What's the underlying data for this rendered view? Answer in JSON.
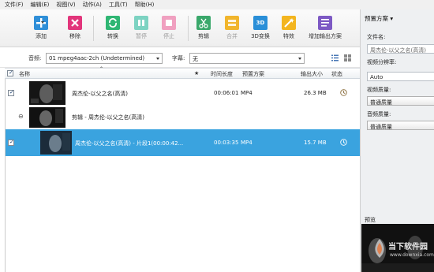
{
  "menu": [
    "文件(F)",
    "编辑(E)",
    "视图(V)",
    "动作(A)",
    "工具(T)",
    "帮助(H)"
  ],
  "toolbar": {
    "add": "添加",
    "remove": "移除",
    "convert": "转换",
    "pause": "暂停",
    "stop": "停止",
    "cut": "剪辑",
    "merge": "合并",
    "convert3d": "3D变换",
    "effects": "特效",
    "add_profile": "增加输出方案",
    "icon_3d_text": "3D"
  },
  "filter": {
    "audio_label": "音频:",
    "audio_value": "01 mpeg4aac-2ch (Undetermined)",
    "subtitle_label": "字幕:",
    "subtitle_value": "无"
  },
  "table": {
    "headers": {
      "name": "名称",
      "star": "★",
      "duration": "时间长度",
      "preset": "预置方案",
      "size": "输出大小",
      "status": "状态"
    },
    "rows": [
      {
        "title": "周杰伦-以父之名(高清)",
        "duration": "00:06:01",
        "preset": "MP4",
        "size": "26.3 MB"
      },
      {
        "title": "剪辑 - 周杰伦-以父之名(高清)",
        "collapse_symbol": "⊖"
      },
      {
        "title": "周杰伦-以父之名(高清) - 片段1(00:00:42...",
        "duration": "00:03:35",
        "preset": "MP4",
        "size": "15.7 MB"
      }
    ]
  },
  "right_panel": {
    "title": "预置方案 ▾",
    "filename_label": "文件名:",
    "filename_value": "周杰伦-以父之名(高清)",
    "resolution_label": "视频分辨率:",
    "resolution_value": "Auto",
    "video_quality_label": "视频质量:",
    "video_quality_value": "普通质量",
    "audio_quality_label": "音频质量:",
    "audio_quality_value": "普通质量",
    "preview_label": "预览"
  },
  "watermark": {
    "line1": "当下软件园",
    "line2": "www.downxia.com"
  },
  "colors": {
    "add": "#2f8fd8",
    "remove": "#e2357b",
    "convert": "#2fb673",
    "pause": "#7dd3c2",
    "stop": "#f0a0c0",
    "cut": "#3aa86b",
    "merge": "#f1b52c",
    "convert3d": "#2a8fd8",
    "effects": "#f3b51f",
    "add_profile": "#7d59c4",
    "selected_row": "#3aa3df"
  }
}
